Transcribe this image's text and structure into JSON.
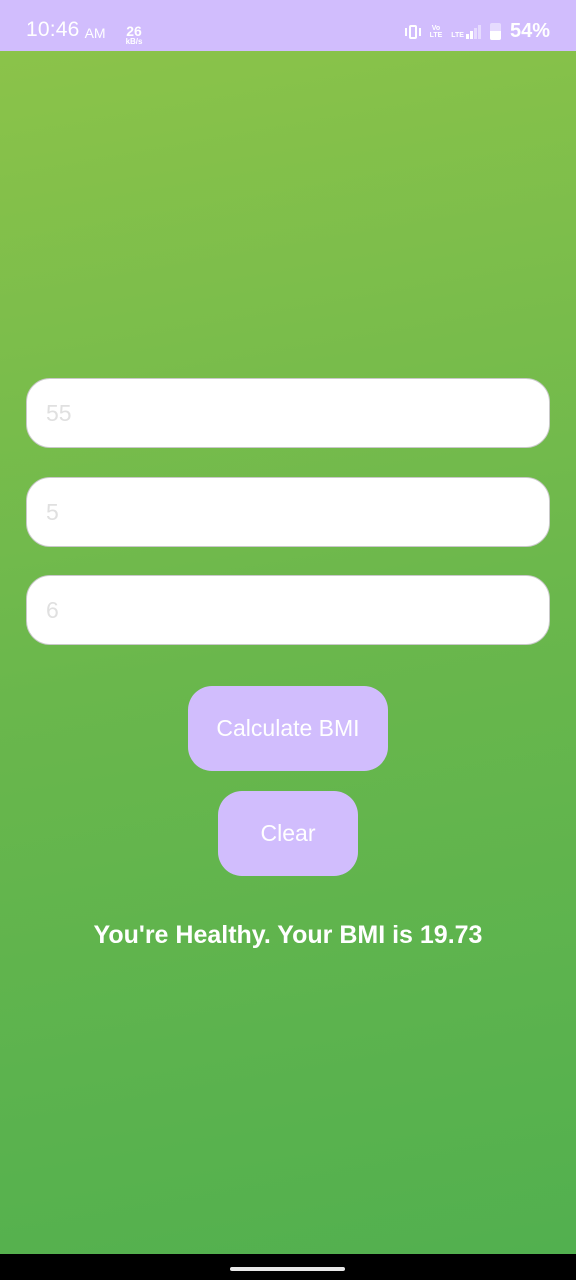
{
  "status_bar": {
    "time": "10:46",
    "ampm": "AM",
    "net_speed": "26",
    "net_speed_unit": "kB/s",
    "volte_label": "Vo LTE",
    "lte_label": "LTE",
    "battery_percent": "54%",
    "icons": [
      "vibrate-icon",
      "volte-icon",
      "lte-signal-icon",
      "battery-icon"
    ]
  },
  "form": {
    "weight_field": {
      "value": "",
      "placeholder": "55"
    },
    "height_feet_field": {
      "value": "",
      "placeholder": "5"
    },
    "height_inches_field": {
      "value": "",
      "placeholder": "6"
    }
  },
  "buttons": {
    "calculate_label": "Calculate BMI",
    "clear_label": "Clear"
  },
  "result": {
    "text": "You're Healthy. Your BMI is 19.73"
  },
  "colors": {
    "accent": "#d1bdfd",
    "background_top": "#8bc34a",
    "background_bottom": "#52b04f"
  }
}
